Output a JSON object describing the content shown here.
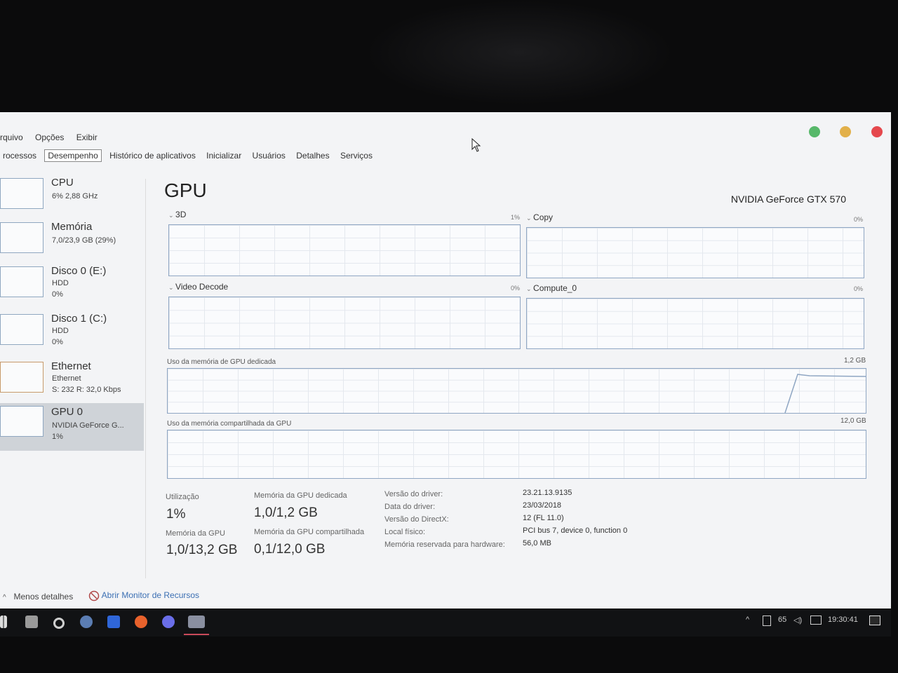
{
  "menu": [
    "rquivo",
    "Opções",
    "Exibir"
  ],
  "tabs": [
    {
      "label": "rocessos",
      "active": false
    },
    {
      "label": "Desempenho",
      "active": true
    },
    {
      "label": "Histórico de aplicativos",
      "active": false
    },
    {
      "label": "Inicializar",
      "active": false
    },
    {
      "label": "Usuários",
      "active": false
    },
    {
      "label": "Detalhes",
      "active": false
    },
    {
      "label": "Serviços",
      "active": false
    }
  ],
  "sidebar": {
    "cpu": {
      "title": "CPU",
      "line1": "6% 2,88 GHz"
    },
    "memory": {
      "title": "Memória",
      "line1": "7,0/23,9 GB (29%)"
    },
    "disk0": {
      "title": "Disco 0 (E:)",
      "line1": "HDD",
      "line2": "0%"
    },
    "disk1": {
      "title": "Disco 1 (C:)",
      "line1": "HDD",
      "line2": "0%"
    },
    "ethernet": {
      "title": "Ethernet",
      "line1": "Ethernet",
      "line2": "S: 232 R: 32,0 Kbps"
    },
    "gpu0": {
      "title": "GPU 0",
      "line1": "NVIDIA GeForce G...",
      "line2": "1%"
    }
  },
  "main": {
    "title": "GPU",
    "device": "NVIDIA GeForce GTX 570",
    "engines": {
      "e3d": {
        "label": "3D",
        "pct": "1%"
      },
      "copy": {
        "label": "Copy",
        "pct": "0%"
      },
      "decode": {
        "label": "Video Decode",
        "pct": "0%"
      },
      "compute": {
        "label": "Compute_0",
        "pct": "0%"
      }
    },
    "dedicated": {
      "label": "Uso da memória de GPU dedicada",
      "max": "1,2 GB"
    },
    "shared": {
      "label": "Uso da memória compartilhada da GPU",
      "max": "12,0 GB"
    }
  },
  "stats": {
    "util_label": "Utilização",
    "util_value": "1%",
    "gpumem_label": "Memória da GPU",
    "gpumem_value": "1,0/13,2 GB",
    "dedmem_label": "Memória da GPU dedicada",
    "dedmem_value": "1,0/1,2 GB",
    "shrmem_label": "Memória da GPU compartilhada",
    "shrmem_value": "0,1/12,0 GB"
  },
  "info": {
    "driver_version_key": "Versão do driver:",
    "driver_version": "23.21.13.9135",
    "driver_date_key": "Data do driver:",
    "driver_date": "23/03/2018",
    "directx_key": "Versão do DirectX:",
    "directx": "12 (FL 11.0)",
    "location_key": "Local físico:",
    "location": "PCI bus 7, device 0, function 0",
    "reserved_key": "Memória reservada para hardware:",
    "reserved": "56,0 MB"
  },
  "footer": {
    "less_details": "Menos detalhes",
    "resource_monitor": "Abrir Monitor de Recursos"
  },
  "tray": {
    "temp": "65",
    "clock": "19:30:41"
  },
  "colors": {
    "accent": "#8fa6c3",
    "close": "#e5484d",
    "minimize": "#57b86a",
    "maximize": "#e2b04a"
  }
}
